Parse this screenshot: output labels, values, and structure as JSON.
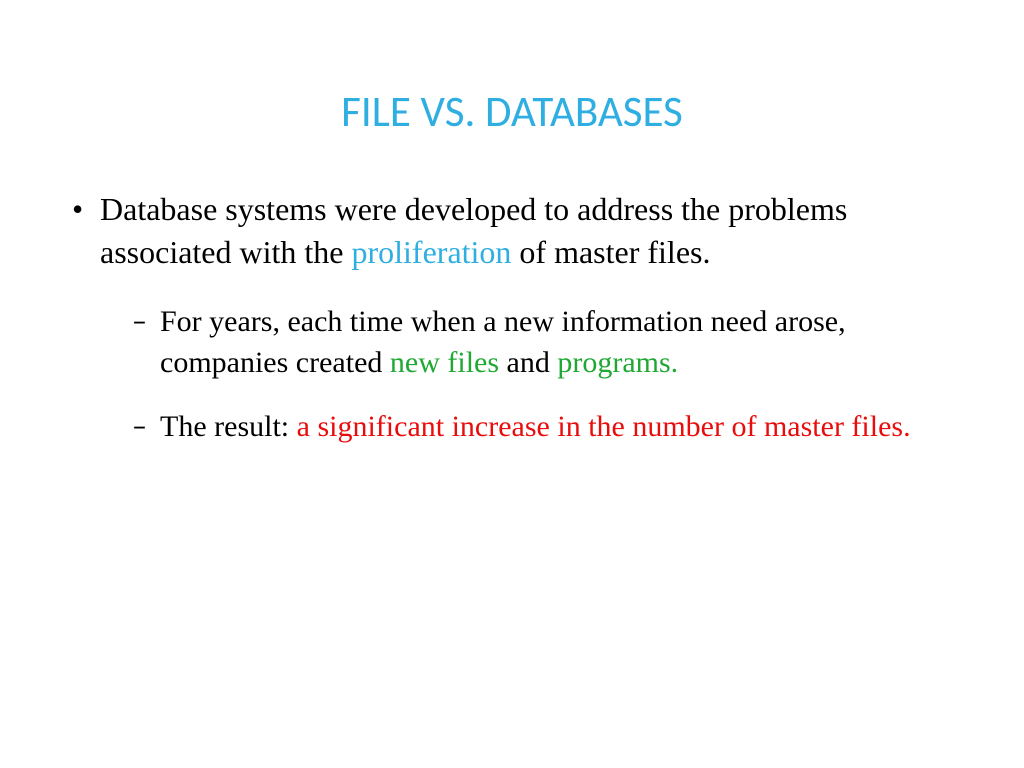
{
  "slide": {
    "title": "FILE VS. DATABASES",
    "bullets": {
      "b1": {
        "p1": "Database systems were developed to address the problems associated with the ",
        "h1": "proliferation",
        "p2": " of master files."
      },
      "b2a": {
        "p1": "For years, each time  when a new information need arose, companies created ",
        "h1": "new files",
        "p2": " and ",
        "h2": "programs."
      },
      "b2b": {
        "p1": "The result:  ",
        "h1": "a significant increase in the number of master files."
      }
    }
  }
}
